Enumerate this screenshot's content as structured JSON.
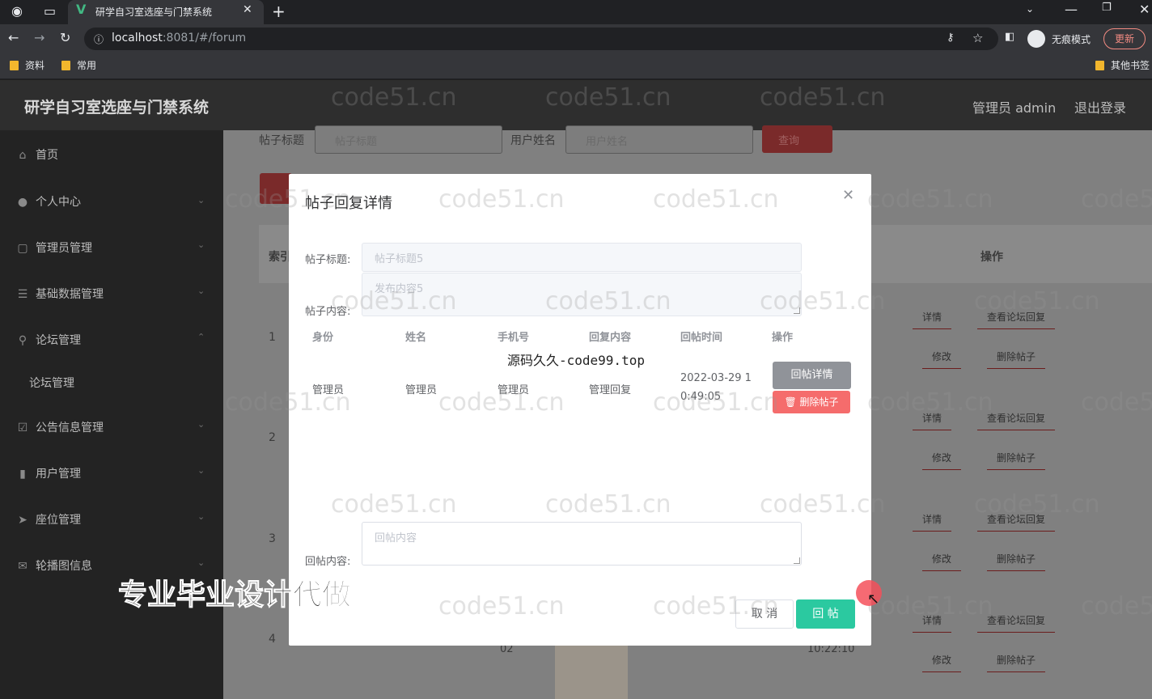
{
  "browser": {
    "tab_title": "研学自习室选座与门禁系统",
    "url_host": "localhost",
    "url_rest": ":8081/#/forum",
    "incognito_label": "无痕模式",
    "update_label": "更新",
    "bookmarks": [
      "资料",
      "常用"
    ],
    "other_bookmarks": "其他书签"
  },
  "app": {
    "title": "研学自习室选座与门禁系统",
    "user": "管理员 admin",
    "logout": "退出登录"
  },
  "sidebar": {
    "items": [
      {
        "label": "首页",
        "icon": "home-icon"
      },
      {
        "label": "个人中心",
        "icon": "user-icon"
      },
      {
        "label": "管理员管理",
        "icon": "admin-icon"
      },
      {
        "label": "基础数据管理",
        "icon": "list-icon"
      },
      {
        "label": "论坛管理",
        "icon": "location-icon"
      },
      {
        "label": "论坛管理",
        "icon": ""
      },
      {
        "label": "公告信息管理",
        "icon": "notice-icon"
      },
      {
        "label": "用户管理",
        "icon": "chart-icon"
      },
      {
        "label": "座位管理",
        "icon": "send-icon"
      },
      {
        "label": "轮播图信息",
        "icon": "mail-icon"
      }
    ]
  },
  "background": {
    "search_title_label": "帖子标题",
    "search_title_placeholder": "帖子标题",
    "search_user_label": "用户姓名",
    "search_user_placeholder": "用户姓名",
    "search_button": "查询",
    "index_header": "索引",
    "ops_header": "操作",
    "row_indices": [
      "1",
      "2",
      "3",
      "4"
    ],
    "op_detail": "详情",
    "op_view_replies": "查看论坛回复",
    "op_edit": "修改",
    "op_delete": "删除帖子",
    "partial_02": "02",
    "partial_time": "10:22:10"
  },
  "modal": {
    "title": "帖子回复详情",
    "post_title_label": "帖子标题:",
    "post_title_value": "帖子标题5",
    "post_content_label": "帖子内容:",
    "post_content_value": "发布内容5",
    "columns": [
      "身份",
      "姓名",
      "手机号",
      "回复内容",
      "回帖时间",
      "操作"
    ],
    "row": {
      "identity": "管理员",
      "name": "管理员",
      "phone": "管理员",
      "content": "管理回复",
      "time": "2022-03-29 10:49:05",
      "detail_button": "回帖详情",
      "delete_button": "删除帖子"
    },
    "reply_label": "回帖内容:",
    "reply_placeholder": "回帖内容",
    "cancel": "取 消",
    "submit": "回 帖"
  },
  "overlays": {
    "watermark": "code51.cn",
    "source_watermark": "源码久久-code99.top",
    "promo": "专业毕业设计代做"
  }
}
